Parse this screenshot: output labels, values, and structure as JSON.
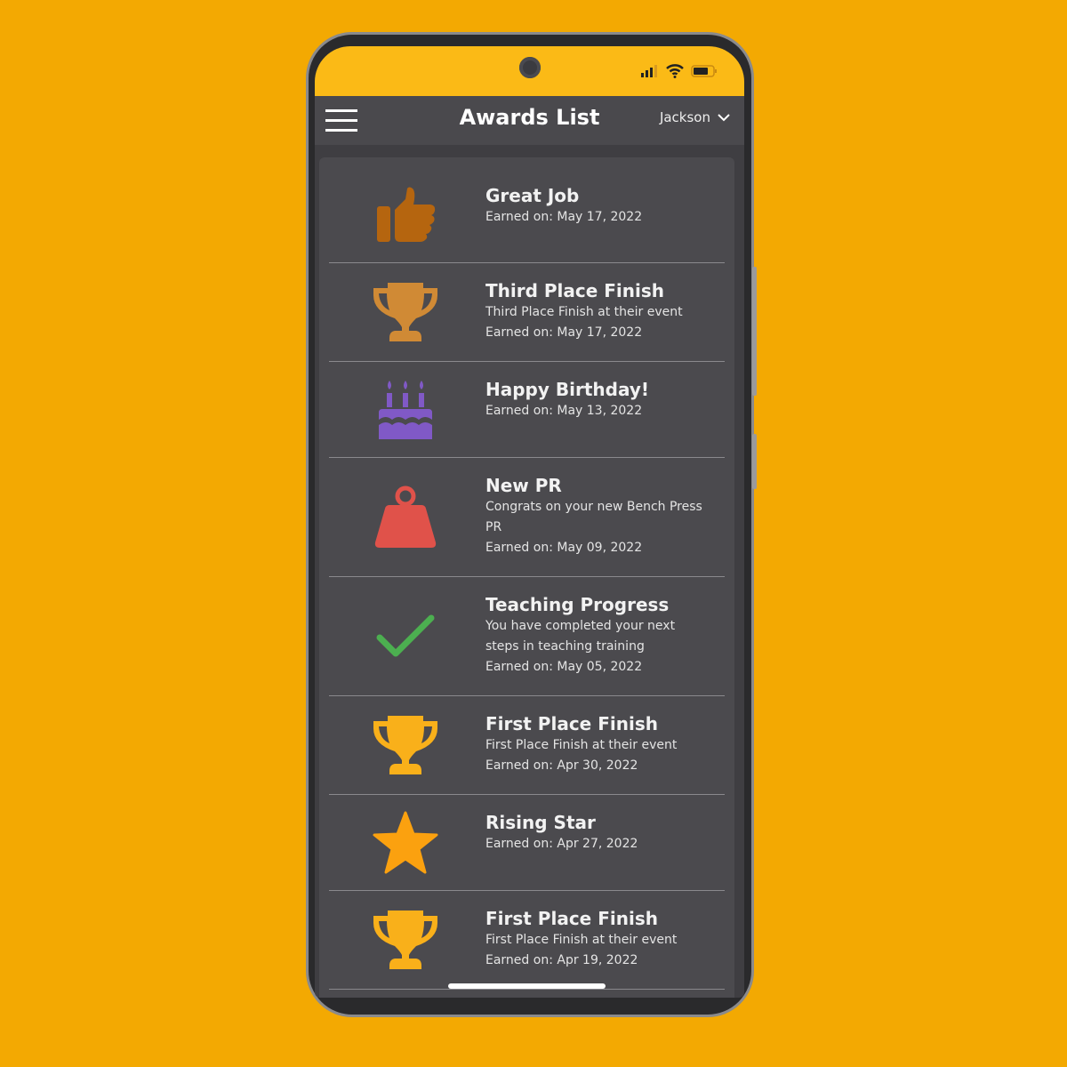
{
  "header": {
    "title": "Awards List",
    "user": "Jackson"
  },
  "colors": {
    "background": "#F3A902",
    "status_bar": "#FBBA16",
    "header": "#4a494d",
    "card": "#4b4a4e"
  },
  "awards": [
    {
      "title": "Great Job",
      "description": "",
      "earned": "Earned on: May 17, 2022",
      "icon": "thumbs-up-icon",
      "color": "#B5650F"
    },
    {
      "title": "Third Place Finish",
      "description": "Third Place Finish at their event",
      "earned": "Earned on: May 17, 2022",
      "icon": "trophy-icon",
      "color": "#D08A35"
    },
    {
      "title": "Happy Birthday!",
      "description": "",
      "earned": "Earned on: May 13, 2022",
      "icon": "birthday-cake-icon",
      "color": "#8059C6"
    },
    {
      "title": "New PR",
      "description": "Congrats on your new Bench Press PR",
      "earned": "Earned on: May 09, 2022",
      "icon": "weight-icon",
      "color": "#E0524A"
    },
    {
      "title": "Teaching Progress",
      "description": "You have completed your next steps in teaching training",
      "earned": "Earned on: May 05, 2022",
      "icon": "checkmark-icon",
      "color": "#4CAF50"
    },
    {
      "title": "First Place Finish",
      "description": "First Place Finish at their event",
      "earned": "Earned on: Apr 30, 2022",
      "icon": "trophy-icon",
      "color": "#F9B01A"
    },
    {
      "title": "Rising Star",
      "description": "",
      "earned": "Earned on: Apr 27, 2022",
      "icon": "star-icon",
      "color": "#FBA10F"
    },
    {
      "title": "First Place Finish",
      "description": "First Place Finish at their event",
      "earned": "Earned on: Apr 19, 2022",
      "icon": "trophy-icon",
      "color": "#F9B01A"
    }
  ]
}
